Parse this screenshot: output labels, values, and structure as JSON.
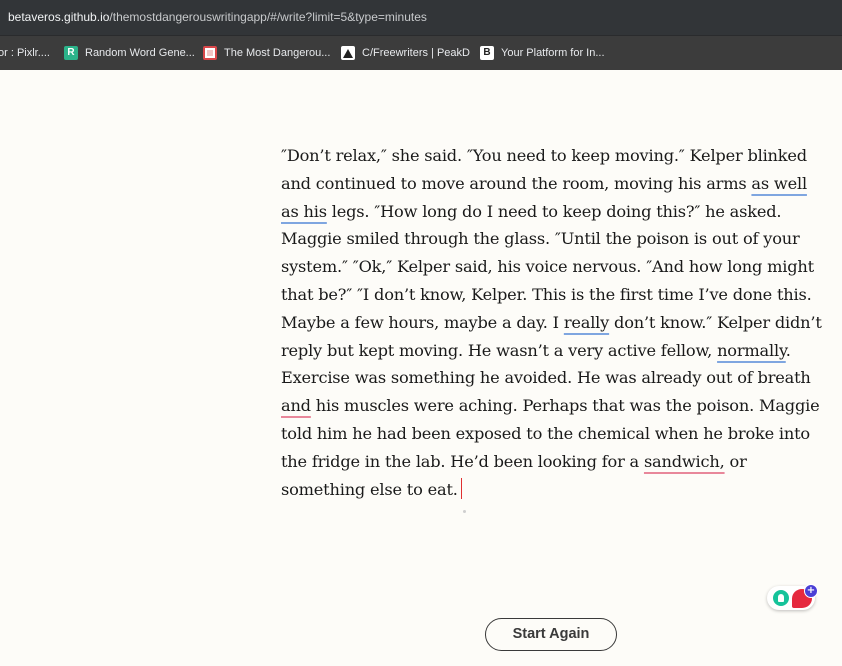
{
  "browser": {
    "url_host": "betaveros.github.io",
    "url_path": "/themostdangerouswritingapp/#/write?limit=5&type=minutes",
    "bookmarks": [
      {
        "label": "or : Pixlr....",
        "icon": "none"
      },
      {
        "label": "Random Word Gene...",
        "icon": "random-word-r-icon"
      },
      {
        "label": "The Most Dangerou...",
        "icon": "dangerous-app-icon"
      },
      {
        "label": "C/Freewriters | PeakD",
        "icon": "peakd-icon"
      },
      {
        "label": "Your Platform for In...",
        "icon": "b-platform-icon"
      }
    ]
  },
  "editor": {
    "lines": [
      [
        {
          "t": "″Don’t relax,″ she said. ″You need to keep moving.″ Kelper blinked"
        }
      ],
      [
        {
          "t": "and continued to move around the room, moving his arms "
        },
        {
          "t": "as well",
          "u": "blue"
        }
      ],
      [
        {
          "t": "as his",
          "u": "blue"
        },
        {
          "t": " legs. ″How long do I need to keep doing this?″ he asked."
        }
      ],
      [
        {
          "t": "Maggie smiled through the glass. ″Until the poison is out of your"
        }
      ],
      [
        {
          "t": "system.″ ″Ok,″ Kelper said, his voice nervous. ″And how long might"
        }
      ],
      [
        {
          "t": "that be?″ ″I don’t know, Kelper. This is the first time I’ve done this."
        }
      ],
      [
        {
          "t": "Maybe a few hours, maybe a day. I "
        },
        {
          "t": "really",
          "u": "blue"
        },
        {
          "t": " don’t know.″ Kelper didn’t"
        }
      ],
      [
        {
          "t": "reply but kept moving. He wasn’t a very active fellow, "
        },
        {
          "t": "normally",
          "u": "blue"
        },
        {
          "t": "."
        }
      ],
      [
        {
          "t": "Exercise was something he avoided. He was already out of breath"
        }
      ],
      [
        {
          "t": "and",
          "u": "red"
        },
        {
          "t": " his muscles were aching. Perhaps that was the poison. Maggie"
        }
      ],
      [
        {
          "t": "told him he had been exposed to the chemical when he broke into"
        }
      ],
      [
        {
          "t": "the fridge in the lab. He’d been looking for a "
        },
        {
          "t": "sandwich,",
          "u": "red"
        },
        {
          "t": " or"
        }
      ],
      [
        {
          "t": "something else to eat."
        }
      ]
    ]
  },
  "grammarly": {
    "badge": "+"
  },
  "start_again_label": "Start Again"
}
